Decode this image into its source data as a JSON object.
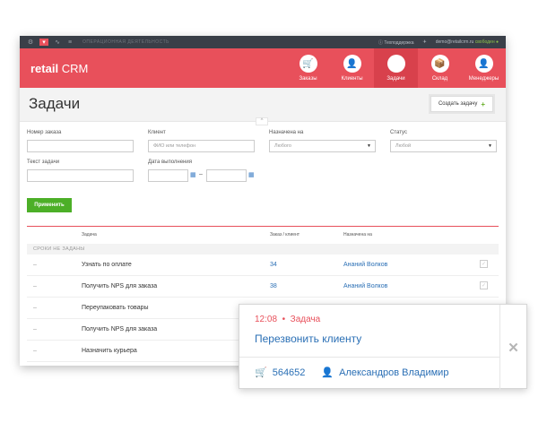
{
  "sysbar": {
    "section": "ОПЕРАЦИОННАЯ ДЕЯТЕЛЬНОСТЬ",
    "support": "Техподдержка",
    "email": "demo@retailcrm.ru",
    "status": "свободен"
  },
  "header": {
    "logo_left": "retail",
    "logo_right": "CRM",
    "nav": [
      {
        "label": "Заказы",
        "icon": "cart-icon",
        "glyph": "🛒"
      },
      {
        "label": "Клиенты",
        "icon": "user-icon",
        "glyph": "👤"
      },
      {
        "label": "Задачи",
        "icon": "chat-icon",
        "glyph": "☰"
      },
      {
        "label": "Склад",
        "icon": "box-icon",
        "glyph": "📦"
      },
      {
        "label": "Менеджеры",
        "icon": "manager-icon",
        "glyph": "👤"
      }
    ]
  },
  "page": {
    "title": "Задачи",
    "create_button": "Создать задачу",
    "create_plus": "+"
  },
  "filters": {
    "order_label": "Номер заказа",
    "client_label": "Клиент",
    "client_placeholder": "ФИО или телефон",
    "assigned_label": "Назначена на",
    "assigned_value": "Любого",
    "status_label": "Статус",
    "status_value": "Любой",
    "text_label": "Текст задачи",
    "date_label": "Дата выполнения",
    "apply_button": "Применить"
  },
  "table": {
    "headers": {
      "task": "Задача",
      "order": "Заказ / клиент",
      "assignee": "Назначена на"
    },
    "group": "СРОКИ НЕ ЗАДАНЫ",
    "rows": [
      {
        "dash": "–",
        "task": "Узнать по оплате",
        "order": "34",
        "assignee": "Ананий Волков"
      },
      {
        "dash": "–",
        "task": "Получить NPS для заказа",
        "order": "38",
        "assignee": "Ананий Волков"
      },
      {
        "dash": "–",
        "task": "Переупаковать товары",
        "order": "",
        "assignee": ""
      },
      {
        "dash": "–",
        "task": "Получить NPS для заказа",
        "order": "",
        "assignee": ""
      },
      {
        "dash": "–",
        "task": "Назначить курьера",
        "order": "",
        "assignee": ""
      }
    ]
  },
  "popup": {
    "time": "12:08",
    "bullet": "•",
    "type": "Задача",
    "title": "Перезвонить клиенту",
    "order": "564652",
    "client": "Александров Владимир",
    "close": "✕"
  },
  "colors": {
    "brand": "#e8505b",
    "link": "#2a6fb5",
    "apply": "#4caf27"
  }
}
